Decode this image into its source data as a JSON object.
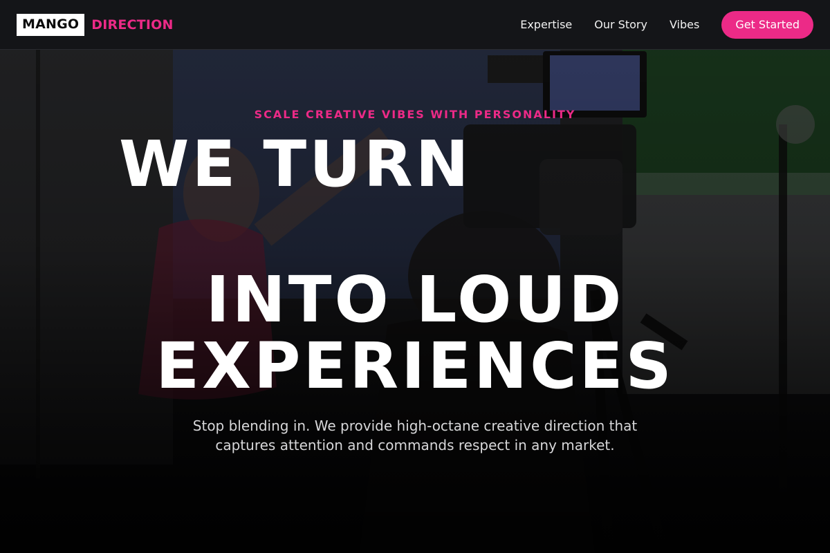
{
  "header": {
    "logo_primary": "MANGO",
    "logo_secondary": "DIRECTION",
    "nav": [
      {
        "label": "Expertise"
      },
      {
        "label": "Our Story"
      },
      {
        "label": "Vibes"
      }
    ],
    "cta_label": "Get Started"
  },
  "hero": {
    "eyebrow": "SCALE CREATIVE VIBES WITH PERSONALITY",
    "headline_line1": "WE TURN",
    "headline_line2": "INTO LOUD",
    "headline_line3": "EXPERIENCES",
    "subtext": "Stop blending in. We provide high-octane creative direction that captures attention and commands respect in any market.",
    "background_image": "film-studio-camera-photo"
  },
  "colors": {
    "accent": "#ec2a87",
    "header_bg": "#141518",
    "text_primary": "#ffffff",
    "text_muted": "#d7d7d9"
  }
}
